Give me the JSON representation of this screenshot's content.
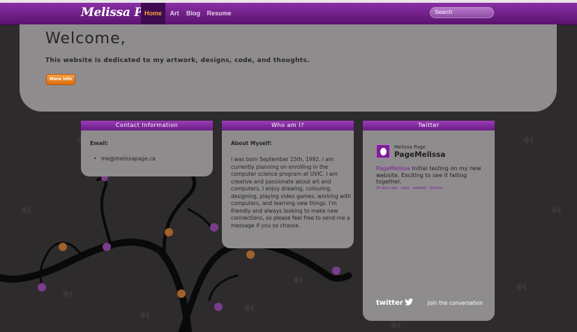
{
  "site": {
    "logo": "Melissa Page",
    "nav": [
      "Home",
      "Art",
      "Blog",
      "Resume"
    ],
    "active_nav": "Home",
    "search_placeholder": "Search"
  },
  "hero": {
    "title": "Welcome,",
    "subtitle": "This website is dedicated to my artwork, designs, code, and thoughts.",
    "button": "More info"
  },
  "contact": {
    "header": "Contact Information",
    "email_label": "Email:",
    "email": "me@melissapage.ca"
  },
  "about": {
    "header": "Who am I?",
    "title": "About Myself:",
    "text": "I was born September 15th, 1992. I am currently planning on enrolling in the computer science program at UVIC. I am creative and passionate about art and computers. I enjoy drawing, colouring, designing, playing video games, working with computers, and learning new things. I'm friendly and always looking to make new connections, so please feel free to send me a message if you so choose."
  },
  "twitter": {
    "header": "Twitter",
    "name": "Melissa Page",
    "handle": "PageMelissa",
    "tweet_user": "PageMelissa",
    "tweet_text": " Initial testing on my new website. Exciting to see it falling together.",
    "meta": "29 days ago · reply · retweet · favorite",
    "brand": "twitter",
    "join": "Join the conversation"
  },
  "colors": {
    "nav_purple": "#6b1a84",
    "accent_orange": "#f4a33b",
    "panel_gray": "#8f8c8e"
  }
}
